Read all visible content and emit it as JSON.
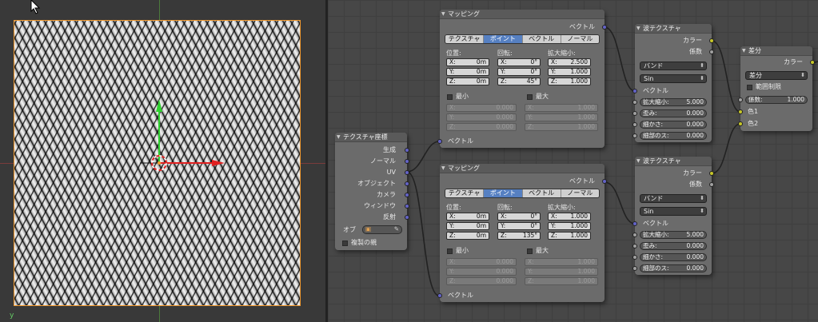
{
  "colors": {
    "selection_outline": "#f39a2e",
    "node_header": "#5a5a5a",
    "node_body": "#6b6b6b",
    "active_tab": "#5680c2",
    "socket_vector": "#6363c7",
    "socket_color": "#c7c729",
    "socket_value": "#a1a1a1"
  },
  "viewport": {
    "axis_label": "y",
    "cursor": "arrow-cursor"
  },
  "texcoord": {
    "title": "テクスチャ座標",
    "outputs": [
      "生成",
      "ノーマル",
      "UV",
      "オブジェクト",
      "カメラ",
      "ウィンドウ",
      "反射"
    ],
    "ob_label": "オブ",
    "dupli_label": "複製の親"
  },
  "mapping1": {
    "title": "マッピング",
    "out_label": "ベクトル",
    "tabs": [
      "テクスチャ",
      "ポイント",
      "ベクトル",
      "ノーマル"
    ],
    "active_tab": 1,
    "loc_label": "位置:",
    "rot_label": "回転:",
    "scale_label": "拡大縮小:",
    "loc": [
      [
        "X:",
        "0m"
      ],
      [
        "Y:",
        "0m"
      ],
      [
        "Z:",
        "0m"
      ]
    ],
    "rot": [
      [
        "X:",
        "0°"
      ],
      [
        "Y:",
        "0°"
      ],
      [
        "Z:",
        "45°"
      ]
    ],
    "scale": [
      [
        "X:",
        "2.500"
      ],
      [
        "Y:",
        "1.000"
      ],
      [
        "Z:",
        "1.000"
      ]
    ],
    "min_label": "最小",
    "max_label": "最大",
    "min": [
      [
        "X:",
        "0.000"
      ],
      [
        "Y:",
        "0.000"
      ],
      [
        "Z:",
        "0.000"
      ]
    ],
    "max": [
      [
        "X:",
        "1.000"
      ],
      [
        "Y:",
        "1.000"
      ],
      [
        "Z:",
        "1.000"
      ]
    ],
    "in_label": "ベクトル"
  },
  "mapping2": {
    "title": "マッピング",
    "out_label": "ベクトル",
    "tabs": [
      "テクスチャ",
      "ポイント",
      "ベクトル",
      "ノーマル"
    ],
    "active_tab": 1,
    "loc_label": "位置:",
    "rot_label": "回転:",
    "scale_label": "拡大縮小:",
    "loc": [
      [
        "X:",
        "0m"
      ],
      [
        "Y:",
        "0m"
      ],
      [
        "Z:",
        "0m"
      ]
    ],
    "rot": [
      [
        "X:",
        "0°"
      ],
      [
        "Y:",
        "0°"
      ],
      [
        "Z:",
        "135°"
      ]
    ],
    "scale": [
      [
        "X:",
        "1.000"
      ],
      [
        "Y:",
        "1.000"
      ],
      [
        "Z:",
        "1.000"
      ]
    ],
    "min_label": "最小",
    "max_label": "最大",
    "min": [
      [
        "X:",
        "0.000"
      ],
      [
        "Y:",
        "0.000"
      ],
      [
        "Z:",
        "0.000"
      ]
    ],
    "max": [
      [
        "X:",
        "1.000"
      ],
      [
        "Y:",
        "1.000"
      ],
      [
        "Z:",
        "1.000"
      ]
    ],
    "in_label": "ベクトル"
  },
  "wave1": {
    "title": "波テクスチャ",
    "out_color": "カラー",
    "out_fac": "係数",
    "type": "バンド",
    "profile": "Sin",
    "in_vector": "ベクトル",
    "fields": [
      [
        "拡大縮小:",
        "5.000"
      ],
      [
        "歪み:",
        "0.000"
      ],
      [
        "細かさ:",
        "0.000"
      ],
      [
        "細部のス:",
        "0.000"
      ]
    ]
  },
  "wave2": {
    "title": "波テクスチャ",
    "out_color": "カラー",
    "out_fac": "係数",
    "type": "バンド",
    "profile": "Sin",
    "in_vector": "ベクトル",
    "fields": [
      [
        "拡大縮小:",
        "5.000"
      ],
      [
        "歪み:",
        "0.000"
      ],
      [
        "細かさ:",
        "0.000"
      ],
      [
        "細部のス:",
        "0.000"
      ]
    ]
  },
  "mix": {
    "title": "差分",
    "out_color": "カラー",
    "blend": "差分",
    "clamp": "範囲制限",
    "fac_label": "係数:",
    "fac_value": "1.000",
    "color1": "色1",
    "color2": "色2"
  }
}
